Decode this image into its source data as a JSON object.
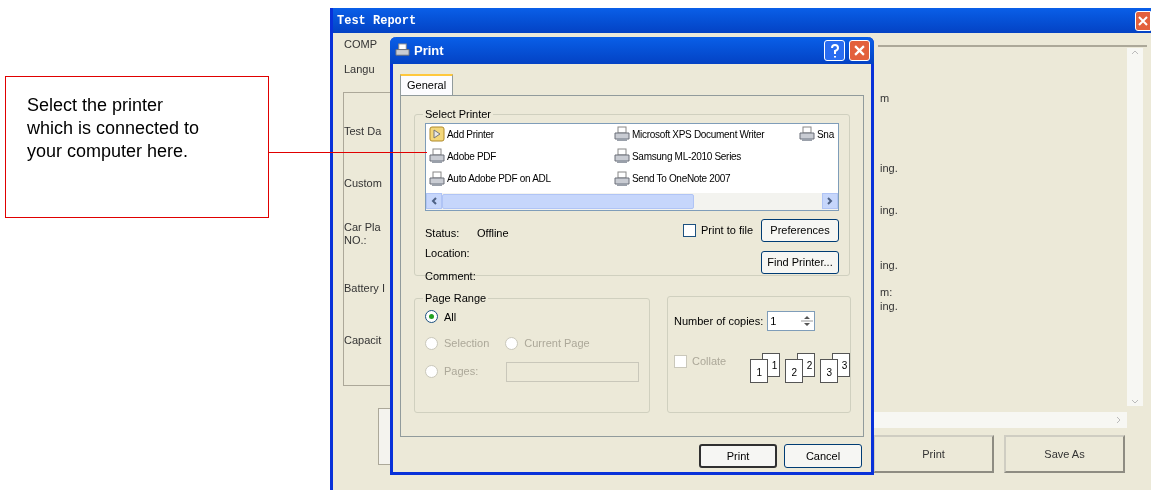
{
  "callout": {
    "text": "Select the printer which is connected to your computer here."
  },
  "report_window": {
    "title": "Test Report",
    "left_labels": [
      "COMP",
      "Langu",
      "Test Da",
      "Custom",
      "Car Pla",
      "NO.:",
      "Battery I",
      "Capacit"
    ],
    "right_fragments": [
      "m",
      "ing.",
      "ing.",
      "ing.",
      "m:",
      "ing."
    ],
    "buttons": [
      "Print",
      "Save As"
    ]
  },
  "print_dialog": {
    "title": "Print",
    "tabs": [
      {
        "label": "General",
        "selected": true
      }
    ],
    "select_printer": {
      "heading": "Select Printer",
      "printers": [
        {
          "name": "Add Printer",
          "kind": "add"
        },
        {
          "name": "Adobe PDF",
          "kind": "printer"
        },
        {
          "name": "Auto Adobe PDF on ADL",
          "kind": "printer"
        },
        {
          "name": "Microsoft XPS Document Writer",
          "kind": "printer"
        },
        {
          "name": "Samsung ML-2010 Series",
          "kind": "printer"
        },
        {
          "name": "Send To OneNote 2007",
          "kind": "printer"
        },
        {
          "name": "Sna",
          "kind": "printer"
        }
      ],
      "status_label": "Status:",
      "status": "Offline",
      "location_label": "Location:",
      "comment_label": "Comment:",
      "print_to_file": {
        "label": "Print to file",
        "checked": false
      },
      "buttons": [
        "Preferences",
        "Find Printer..."
      ]
    },
    "page_range": {
      "heading": "Page Range",
      "options": [
        {
          "label": "All",
          "selected": true,
          "disabled": false
        },
        {
          "label": "Selection",
          "selected": false,
          "disabled": true
        },
        {
          "label": "Current Page",
          "selected": false,
          "disabled": true
        },
        {
          "label": "Pages:",
          "selected": false,
          "disabled": true
        }
      ]
    },
    "copies": {
      "label": "Number of copies:",
      "value": "1",
      "collate": {
        "label": "Collate",
        "checked": false,
        "disabled": true
      },
      "collate_pages": [
        {
          "back": "1",
          "front": "1"
        },
        {
          "back": "2",
          "front": "2"
        },
        {
          "back": "3",
          "front": "3"
        }
      ]
    },
    "buttons": [
      "Print",
      "Cancel"
    ]
  }
}
